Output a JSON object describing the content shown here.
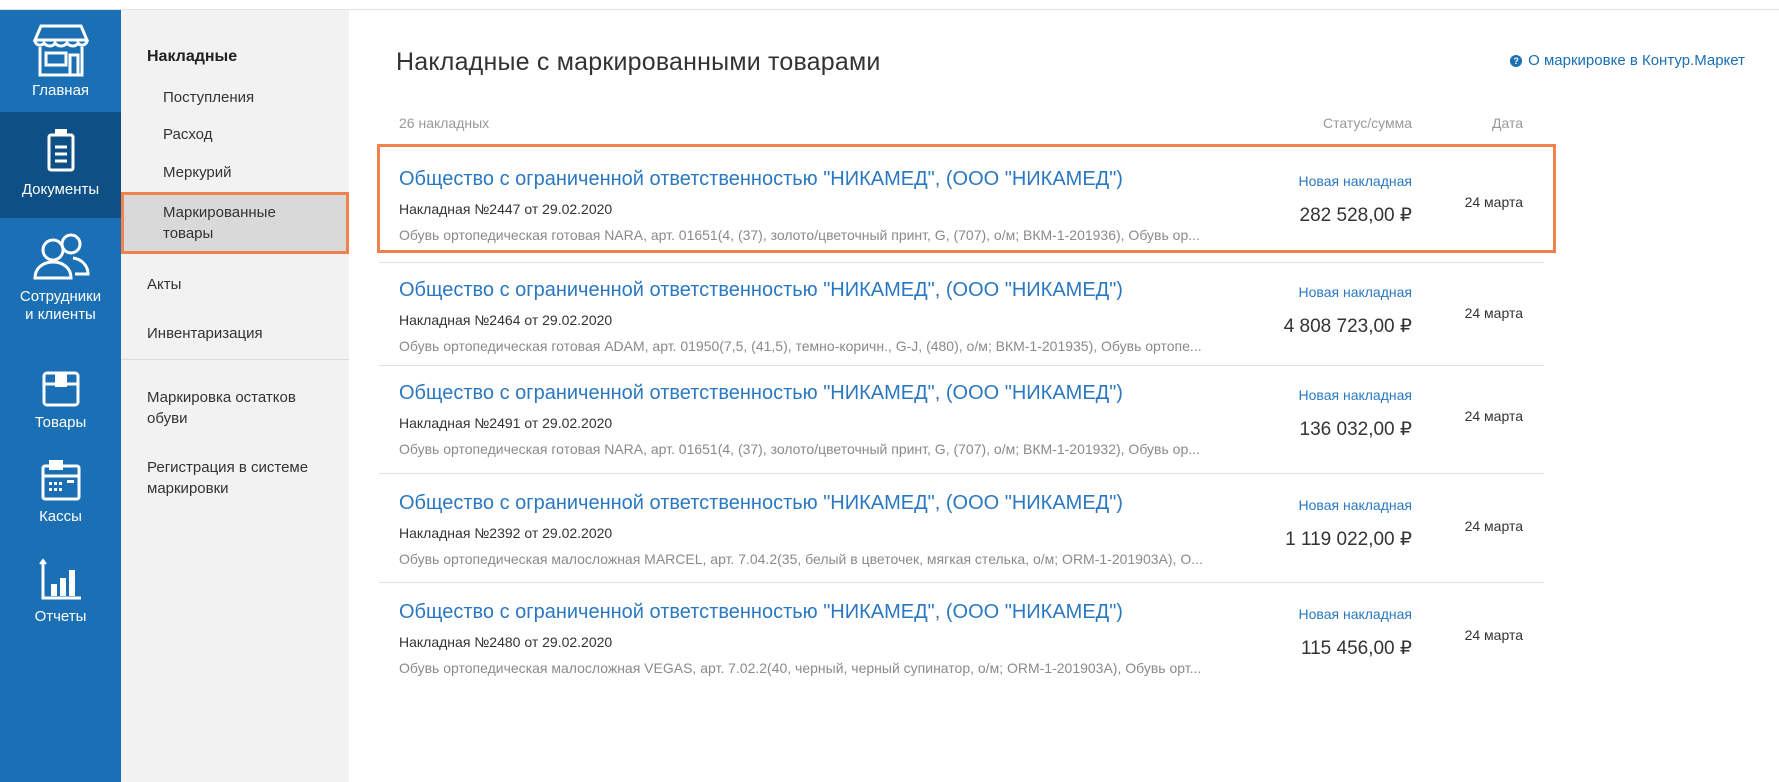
{
  "nav": {
    "items": [
      {
        "label": "Главная",
        "icon": "store-icon"
      },
      {
        "label": "Документы",
        "icon": "clipboard-icon"
      },
      {
        "label_1": "Сотрудники",
        "label_2": "и клиенты",
        "icon": "people-icon"
      },
      {
        "label": "Товары",
        "icon": "box-icon"
      },
      {
        "label": "Кассы",
        "icon": "cash-register-icon"
      },
      {
        "label": "Отчеты",
        "icon": "bar-chart-icon"
      }
    ]
  },
  "submenu": {
    "heading": "Накладные",
    "items": [
      "Поступления",
      "Расход",
      "Меркурий"
    ],
    "selected_1": "Маркированные",
    "selected_2": "товары",
    "acts": "Акты",
    "inventory": "Инвентаризация",
    "mark_1": "Маркировка остатков",
    "mark_2": "обуви",
    "reg_1": "Регистрация в системе",
    "reg_2": "маркировки"
  },
  "main": {
    "title": "Накладные с маркированными товарами",
    "help_link": "О маркировке в Контур.Маркет",
    "count": "26 накладных",
    "col_status": "Статус/сумма",
    "col_date": "Дата"
  },
  "rows": [
    {
      "company": "Общество с ограниченной ответственностью \"НИКАМЕД\", (ООО \"НИКАМЕД\")",
      "number": "Накладная №2447 от 29.02.2020",
      "desc": "Обувь ортопедическая готовая NARA, арт. 01651(4, (37), золото/цветочный принт, G, (707), о/м; ВКМ-1-201936), Обувь ор...",
      "status": "Новая накладная",
      "sum": "282 528,00 ₽",
      "date": "24 марта"
    },
    {
      "company": "Общество с ограниченной ответственностью \"НИКАМЕД\", (ООО \"НИКАМЕД\")",
      "number": "Накладная №2464 от 29.02.2020",
      "desc": "Обувь ортопедическая готовая ADAM, арт. 01950(7,5, (41,5), темно-коричн., G-J, (480), о/м; ВКМ-1-201935), Обувь ортопе...",
      "status": "Новая накладная",
      "sum": "4 808 723,00 ₽",
      "date": "24 марта"
    },
    {
      "company": "Общество с ограниченной ответственностью \"НИКАМЕД\", (ООО \"НИКАМЕД\")",
      "number": "Накладная №2491 от 29.02.2020",
      "desc": "Обувь ортопедическая готовая NARA, арт. 01651(4, (37), золото/цветочный принт, G, (707), о/м; ВКМ-1-201932), Обувь ор...",
      "status": "Новая накладная",
      "sum": "136 032,00 ₽",
      "date": "24 марта"
    },
    {
      "company": "Общество с ограниченной ответственностью \"НИКАМЕД\", (ООО \"НИКАМЕД\")",
      "number": "Накладная №2392 от 29.02.2020",
      "desc": "Обувь ортопедическая малосложная MARCEL, арт. 7.04.2(35, белый в цветочек, мягкая стелька, о/м; ORM-1-201903A), О...",
      "status": "Новая накладная",
      "sum": "1 119 022,00 ₽",
      "date": "24 марта"
    },
    {
      "company": "Общество с ограниченной ответственностью \"НИКАМЕД\", (ООО \"НИКАМЕД\")",
      "number": "Накладная №2480 от 29.02.2020",
      "desc": "Обувь ортопедическая малосложная VEGAS, арт. 7.02.2(40, черный, черный супинатор, о/м; ORM-1-201903A), Обувь орт...",
      "status": "Новая накладная",
      "sum": "115 456,00 ₽",
      "date": "24 марта"
    }
  ],
  "colors": {
    "nav_bg": "#1a6fb5",
    "nav_active": "#0e4f86",
    "link": "#2a78c2",
    "highlight": "#f0834d"
  }
}
